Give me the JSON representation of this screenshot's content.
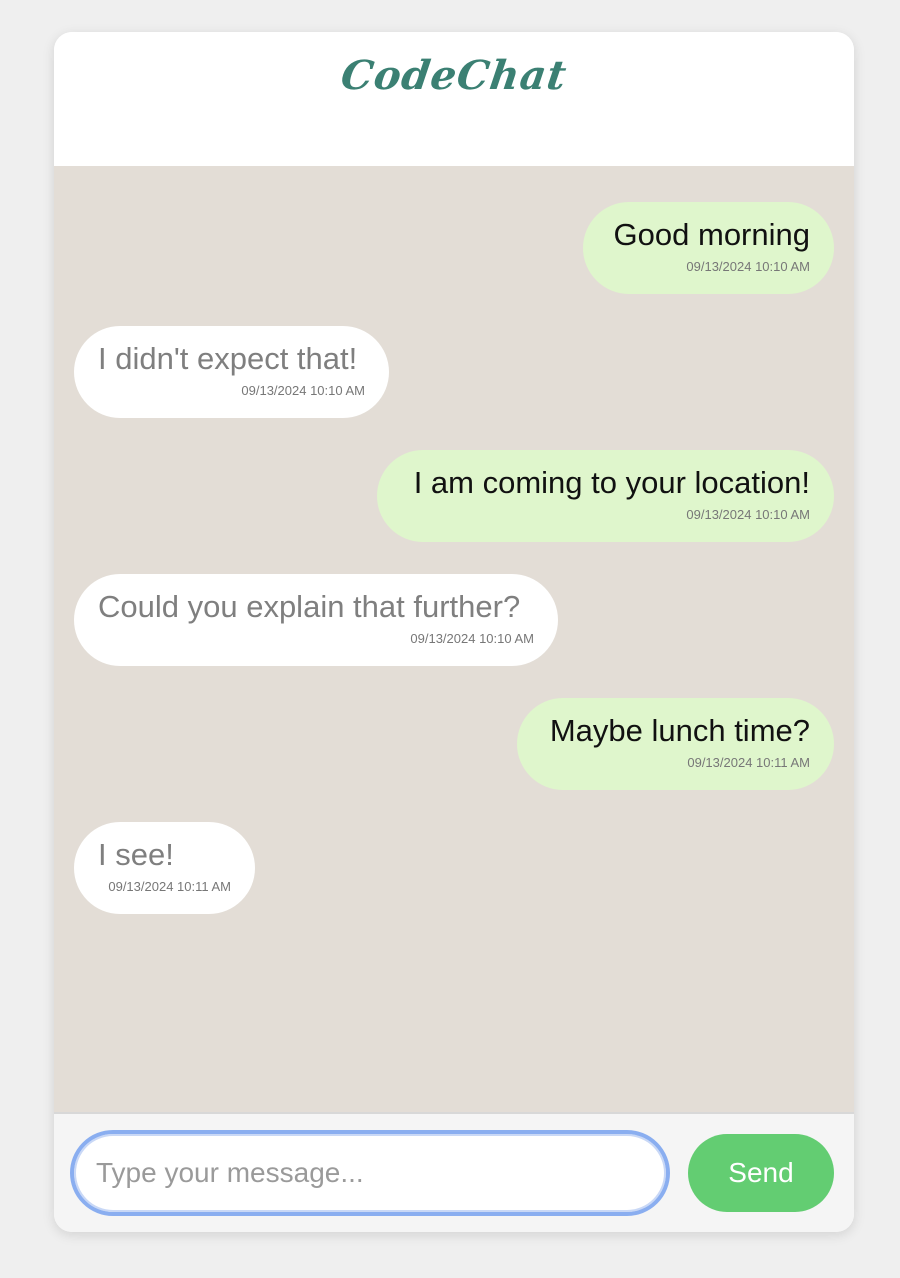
{
  "app": {
    "title": "CodeChat",
    "accent_color": "#3b8073"
  },
  "messages": [
    {
      "direction": "sent",
      "text": "Good morning",
      "time": "09/13/2024 10:10 AM"
    },
    {
      "direction": "received",
      "text": "I didn't expect that!",
      "time": "09/13/2024 10:10 AM"
    },
    {
      "direction": "sent",
      "text": "I am coming to your location!",
      "time": "09/13/2024 10:10 AM"
    },
    {
      "direction": "received",
      "text": "Could you explain that further?",
      "time": "09/13/2024 10:10 AM"
    },
    {
      "direction": "sent",
      "text": "Maybe lunch time?",
      "time": "09/13/2024 10:11 AM"
    },
    {
      "direction": "received",
      "text": "I see!",
      "time": "09/13/2024 10:11 AM"
    }
  ],
  "composer": {
    "placeholder": "Type your message...",
    "value": "",
    "send_label": "Send",
    "send_color": "#63cd72"
  },
  "colors": {
    "sent_bubble": "#dff6cc",
    "received_bubble": "#ffffff",
    "chat_background": "#e3ddd6"
  }
}
